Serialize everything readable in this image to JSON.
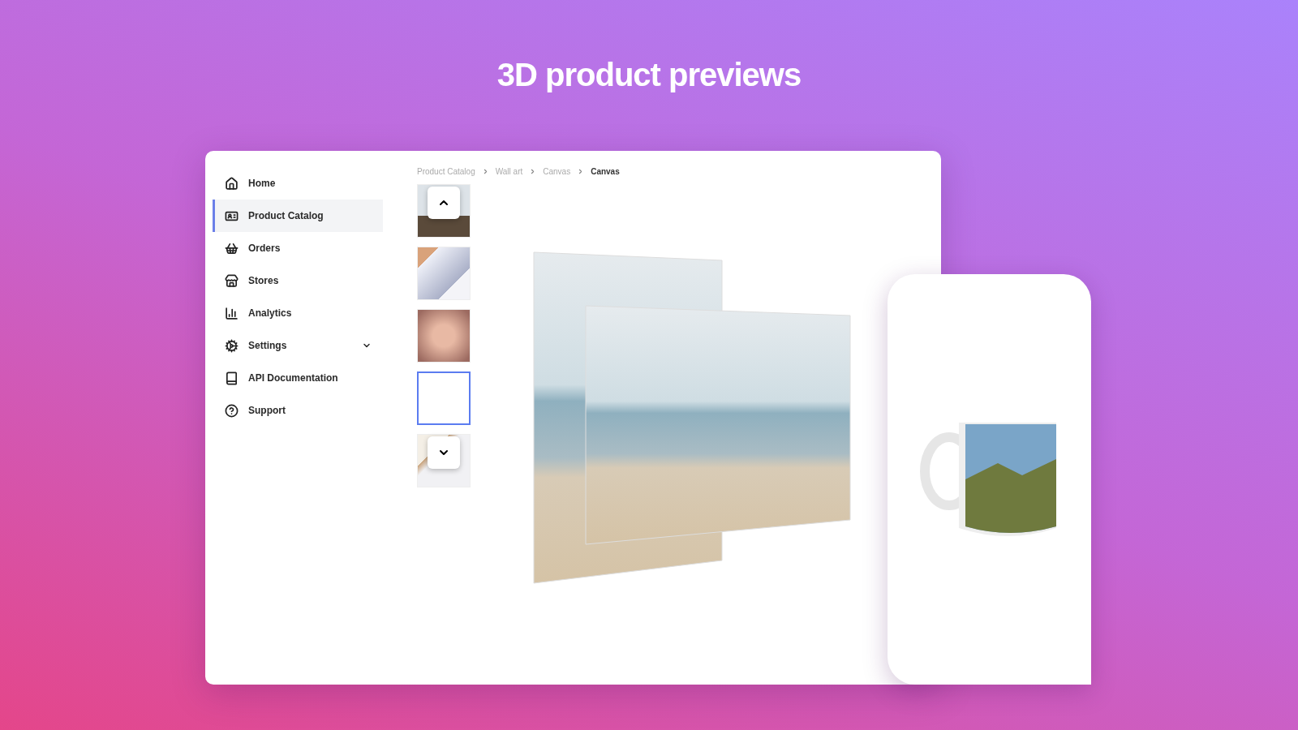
{
  "headline": "3D product previews",
  "sidebar": {
    "items": [
      {
        "label": "Home",
        "selected": false,
        "kind": "link"
      },
      {
        "label": "Product Catalog",
        "selected": true,
        "kind": "link"
      },
      {
        "label": "Orders",
        "selected": false,
        "kind": "link"
      },
      {
        "label": "Stores",
        "selected": false,
        "kind": "link"
      },
      {
        "label": "Analytics",
        "selected": false,
        "kind": "link"
      },
      {
        "label": "Settings",
        "selected": false,
        "kind": "group"
      },
      {
        "label": "API Documentation",
        "selected": false,
        "kind": "link"
      },
      {
        "label": "Support",
        "selected": false,
        "kind": "link"
      }
    ]
  },
  "breadcrumb": [
    "Product Catalog",
    "Wall art",
    "Canvas",
    "Canvas"
  ],
  "thumbnails": [
    {
      "selected": false
    },
    {
      "selected": false
    },
    {
      "selected": false
    },
    {
      "selected": true
    },
    {
      "selected": false
    }
  ]
}
